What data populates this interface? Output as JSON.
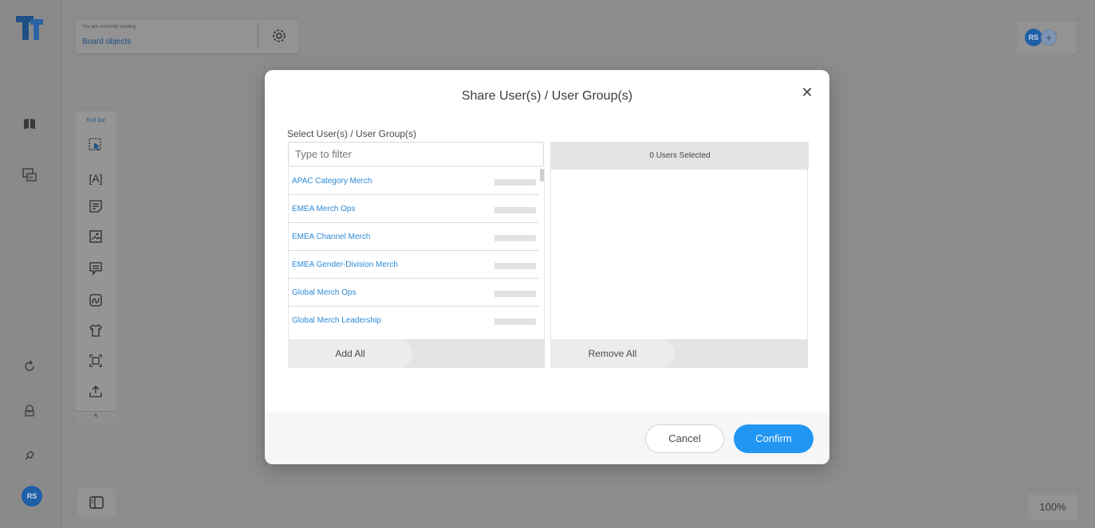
{
  "header": {
    "viewing_caption": "You are currently viewing:",
    "viewing_value": "Board objects"
  },
  "user": {
    "initials": "RS"
  },
  "toolbar": {
    "label": "Tool bar",
    "collapse": "^"
  },
  "zoom": {
    "level": "100%"
  },
  "modal": {
    "title": "Share User(s) / User Group(s)",
    "close": "✕",
    "select_label": "Select User(s) / User Group(s)",
    "filter_placeholder": "Type to filter",
    "groups": [
      {
        "name": "APAC Category Merch"
      },
      {
        "name": "EMEA Merch Ops"
      },
      {
        "name": "EMEA Channel Merch"
      },
      {
        "name": "EMEA Gender-Division Merch"
      },
      {
        "name": "Global Merch Ops"
      },
      {
        "name": "Global Merch Leadership"
      }
    ],
    "add_all": "Add All",
    "selected_count": "0 Users Selected",
    "remove_all": "Remove All",
    "cancel": "Cancel",
    "confirm": "Confirm"
  },
  "colors": {
    "accent": "#2196f3",
    "link": "#2a89d6",
    "avatar": "#1e5fa8"
  }
}
